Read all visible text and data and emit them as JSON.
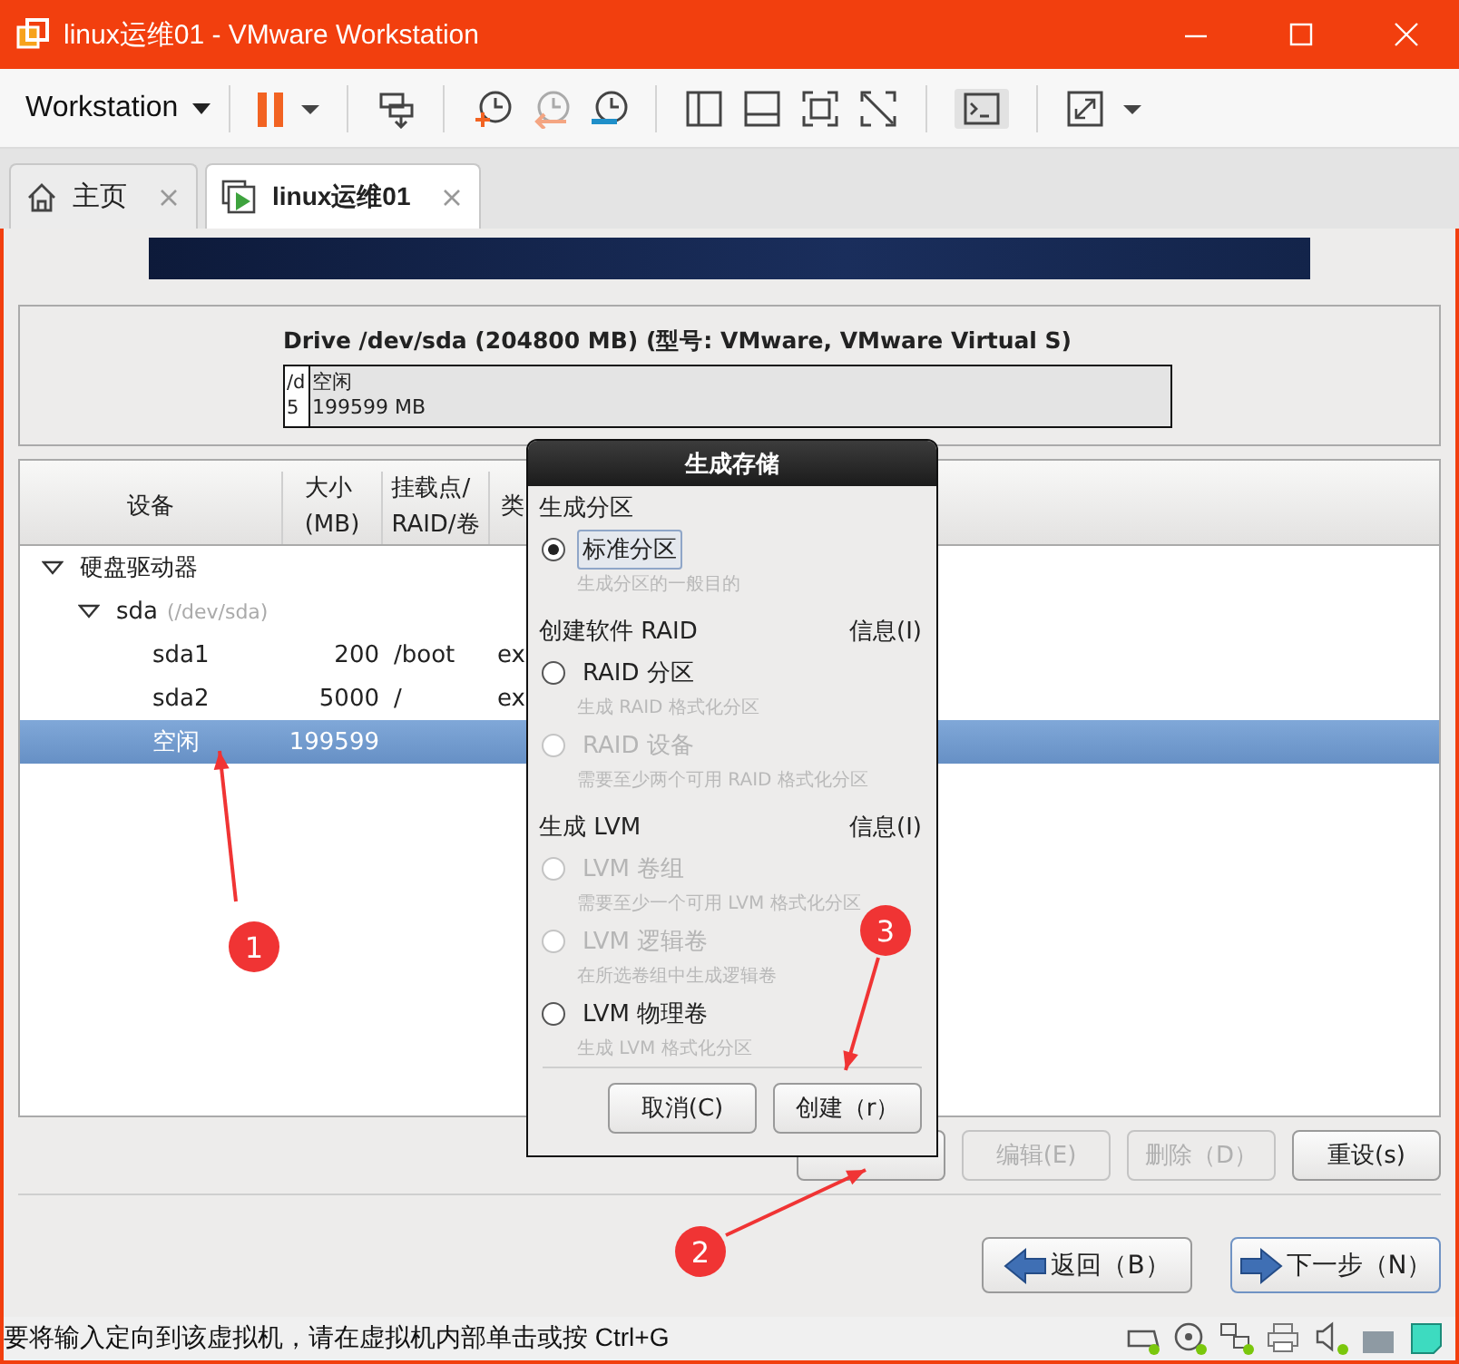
{
  "window": {
    "title": "linux运维01 - VMware Workstation"
  },
  "toolbar": {
    "menu": "Workstation"
  },
  "tabs": [
    {
      "label": "主页",
      "selected": false
    },
    {
      "label": "linux运维01",
      "selected": true
    }
  ],
  "drive": {
    "title": "Drive /dev/sda (204800 MB) (型号: VMware, VMware Virtual S)",
    "segments": [
      {
        "line_1": "/d",
        "line_2": "5"
      },
      {
        "line_1": "空闲",
        "line_2": "199599 MB"
      }
    ]
  },
  "table": {
    "columns": [
      {
        "lines": [
          "设备"
        ]
      },
      {
        "lines": [
          "大小",
          "(MB)"
        ]
      },
      {
        "lines": [
          "挂载点/",
          "RAID/卷"
        ]
      },
      {
        "lines": [
          "类"
        ]
      }
    ],
    "rows": [
      {
        "device": "硬盘驱动器",
        "expanded": true,
        "selected": false,
        "children": [
          {
            "device": "sda",
            "note": "(/dev/sda)",
            "expanded": true,
            "selected": false,
            "children": [
              {
                "device": "sda1",
                "size": "200",
                "mount": "/boot",
                "type": "ex",
                "selected": false
              },
              {
                "device": "sda2",
                "size": "5000",
                "mount": "/",
                "type": "ex",
                "selected": false
              },
              {
                "device": "空闲",
                "size": "199599",
                "selected": true
              }
            ]
          }
        ]
      }
    ]
  },
  "actions": [
    {
      "disabled": false
    },
    {
      "label": "编辑(E)",
      "disabled": true
    },
    {
      "label": "删除（D）",
      "disabled": true
    },
    {
      "label": "重设(s)",
      "disabled": false
    }
  ],
  "nav": [
    {
      "label": "返回（B）",
      "kind": "back",
      "focused": false
    },
    {
      "label": "下一步（N）",
      "kind": "next",
      "focused": true
    }
  ],
  "dialog": {
    "title": "生成存储",
    "sections": [
      {
        "heading": "生成分区",
        "options": [
          {
            "label": "标准分区",
            "hint": "生成分区的一般目的",
            "selected": true,
            "disabled": false
          }
        ]
      },
      {
        "heading": "创建软件 RAID",
        "info": "信息(I)",
        "options": [
          {
            "label": "RAID 分区",
            "hint": "生成 RAID 格式化分区",
            "selected": false,
            "disabled": false
          },
          {
            "label": "RAID 设备",
            "hint": "需要至少两个可用 RAID 格式化分区",
            "selected": false,
            "disabled": true
          }
        ]
      },
      {
        "heading": "生成 LVM",
        "info": "信息(I)",
        "options": [
          {
            "label": "LVM 卷组",
            "hint": "需要至少一个可用 LVM 格式化分区",
            "selected": false,
            "disabled": true
          },
          {
            "label": "LVM 逻辑卷",
            "hint": "在所选卷组中生成逻辑卷",
            "selected": false,
            "disabled": true
          },
          {
            "label": "LVM 物理卷",
            "hint": "生成 LVM 格式化分区",
            "selected": false,
            "disabled": false
          }
        ]
      }
    ],
    "buttons": [
      "取消(C)",
      "创建（r）"
    ]
  },
  "annotations": [
    {
      "label": "1"
    },
    {
      "label": "2"
    },
    {
      "label": "3"
    }
  ],
  "status_bar": {
    "message": "要将输入定向到该虚拟机，请在虚拟机内部单击或按 Ctrl+G"
  }
}
